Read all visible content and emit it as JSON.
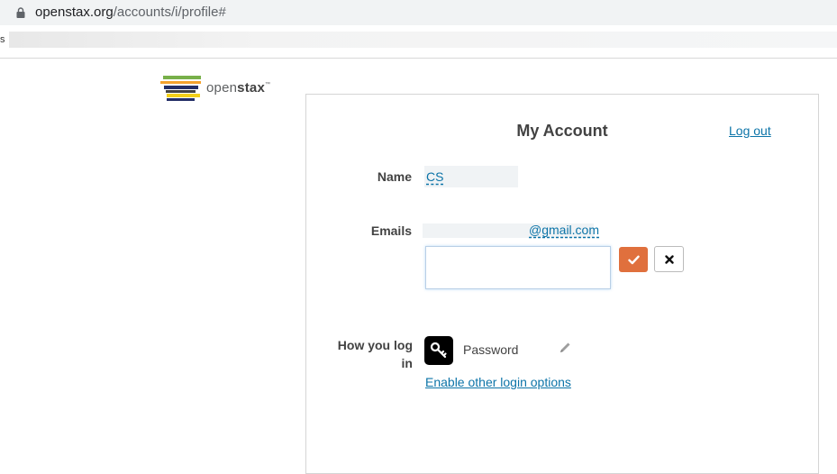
{
  "browser": {
    "url_host": "openstax.org",
    "url_path": "/accounts/i/profile#",
    "bookmark_fragment": "s"
  },
  "logo": {
    "light": "open",
    "bold": "stax",
    "tm": "™",
    "bar_colors": [
      "#78b04a",
      "#f4a22d",
      "#232e66",
      "#424242",
      "#f4d019",
      "#232e66"
    ]
  },
  "profile": {
    "title": "My Account",
    "logout_label": "Log out",
    "name_label": "Name",
    "name_value": "CS",
    "emails_label": "Emails",
    "email_value": "@gmail.com",
    "email_input_value": "",
    "login_label": "How you log in",
    "login_method": "Password",
    "enable_label": "Enable other login options"
  },
  "colors": {
    "link": "#0c74a8",
    "confirm": "#e0703d"
  }
}
